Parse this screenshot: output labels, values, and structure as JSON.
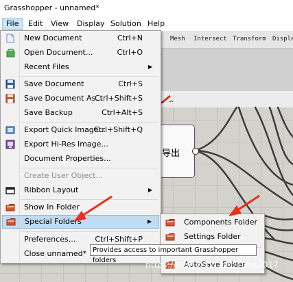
{
  "window": {
    "title": "Grasshopper - unnamed*"
  },
  "menubar": {
    "items": [
      {
        "label": "File",
        "active": true
      },
      {
        "label": "Edit"
      },
      {
        "label": "View"
      },
      {
        "label": "Display"
      },
      {
        "label": "Solution"
      },
      {
        "label": "Help"
      }
    ]
  },
  "ribbon": {
    "tabs": [
      "Mesh",
      "Intersect",
      "Transform",
      "Displa"
    ]
  },
  "component": {
    "label": "导出"
  },
  "file_menu": {
    "items": [
      {
        "label": "New Document",
        "shortcut": "Ctrl+N",
        "icon": "new-document-icon"
      },
      {
        "label": "Open Document...",
        "shortcut": "Ctrl+O",
        "icon": "open-document-icon"
      },
      {
        "label": "Recent Files",
        "submenu": true
      },
      {
        "label": "Save Document",
        "shortcut": "Ctrl+S",
        "icon": "save-icon"
      },
      {
        "label": "Save Document As...",
        "shortcut": "Ctrl+Shift+S",
        "icon": "save-as-icon"
      },
      {
        "label": "Save Backup",
        "shortcut": "Ctrl+Alt+S"
      },
      {
        "label": "Export Quick Image...",
        "shortcut": "Ctrl+Shift+Q",
        "icon": "export-quick-image-icon"
      },
      {
        "label": "Export Hi-Res Image...",
        "icon": "export-hires-image-icon"
      },
      {
        "label": "Document Properties..."
      },
      {
        "label": "Create User Object...",
        "disabled": true
      },
      {
        "label": "Ribbon Layout",
        "submenu": true
      },
      {
        "label": "Show In Folder",
        "icon": "folder-icon"
      },
      {
        "label": "Special Folders",
        "submenu": true,
        "highlighted": true,
        "icon": "folder-icon"
      },
      {
        "label": "Preferences...",
        "shortcut": "Ctrl+Shift+P"
      },
      {
        "label": "Close unnamed*"
      }
    ]
  },
  "special_folders_menu": {
    "items": [
      {
        "label": "Components Folder",
        "icon": "folder-icon"
      },
      {
        "label": "Settings Folder",
        "icon": "folder-icon"
      },
      {
        "label": "AutoSave Folder",
        "icon": "folder-icon"
      }
    ]
  },
  "tooltip": {
    "text": "Provides access to important Grasshopper folders"
  },
  "watermark": {
    "text": "https://blog.csdn.net/Time2017"
  },
  "colors": {
    "highlight": "#c0dcf3",
    "folder": "#d9542f",
    "arrow": "#e8301c",
    "canvas": "#d4d2cc"
  }
}
